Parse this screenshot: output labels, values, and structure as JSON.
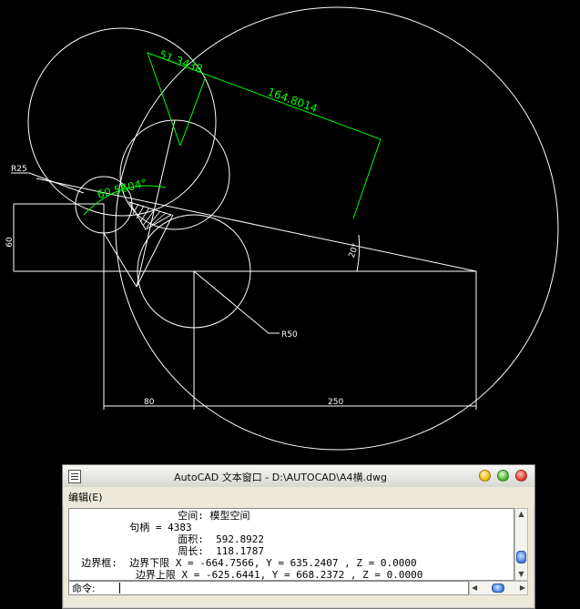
{
  "drawing": {
    "radius_labels": {
      "r25": "R25",
      "r50": "R50"
    },
    "dimensions": {
      "height_60": "60",
      "width_80": "80",
      "width_250": "250",
      "angle_20": "20°",
      "length_51": "51.3438",
      "length_164": "164.8014",
      "angle_60": "60.5604°"
    },
    "colors": {
      "background": "#000000",
      "geometry": "#ffffff",
      "measurement": "#00ff00"
    }
  },
  "text_window": {
    "title": "AutoCAD 文本窗口 - D:\\AUTOCAD\\A4横.dwg",
    "menu": {
      "edit": "编辑(E)"
    },
    "output_lines": [
      "                  空间: 模型空间",
      "          句柄 = 4383",
      "                  面积:  592.8922",
      "                  周长:  118.1787",
      "  边界框:  边界下限 X = -664.7566, Y = 635.2407 , Z = 0.0000",
      "           边界上限 X = -625.6441, Y = 668.2372 , Z = 0.0000"
    ],
    "command_label": "命令:",
    "command_value": ""
  }
}
